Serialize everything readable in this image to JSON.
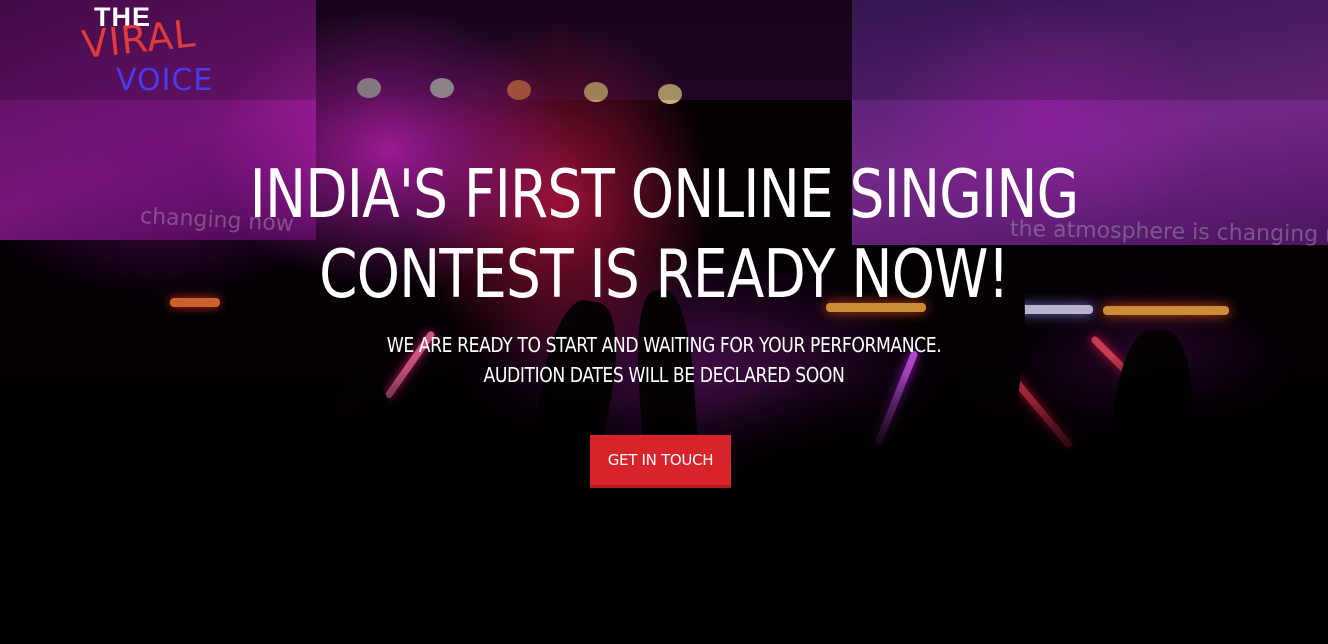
{
  "logo": {
    "line1": "THE",
    "line2": "VIRAL",
    "line3": "VOICE",
    "colors": {
      "the": "#ffffff",
      "viral": "#e03a3a",
      "voice": "#4a3af0"
    }
  },
  "hero": {
    "headline_line1": "INDIA'S FIRST ONLINE SINGING",
    "headline_line2": "CONTEST IS READY NOW!",
    "subline_line1": "WE ARE READY TO START AND WAITING FOR YOUR PERFORMANCE.",
    "subline_line2": "AUDITION DATES WILL BE DECLARED SOON",
    "cta_label": "GET IN TOUCH",
    "background_text_left": "changing now",
    "background_text_right": "the atmosphere is changing now"
  },
  "colors": {
    "accent": "#d9232a",
    "text": "#ffffff"
  }
}
